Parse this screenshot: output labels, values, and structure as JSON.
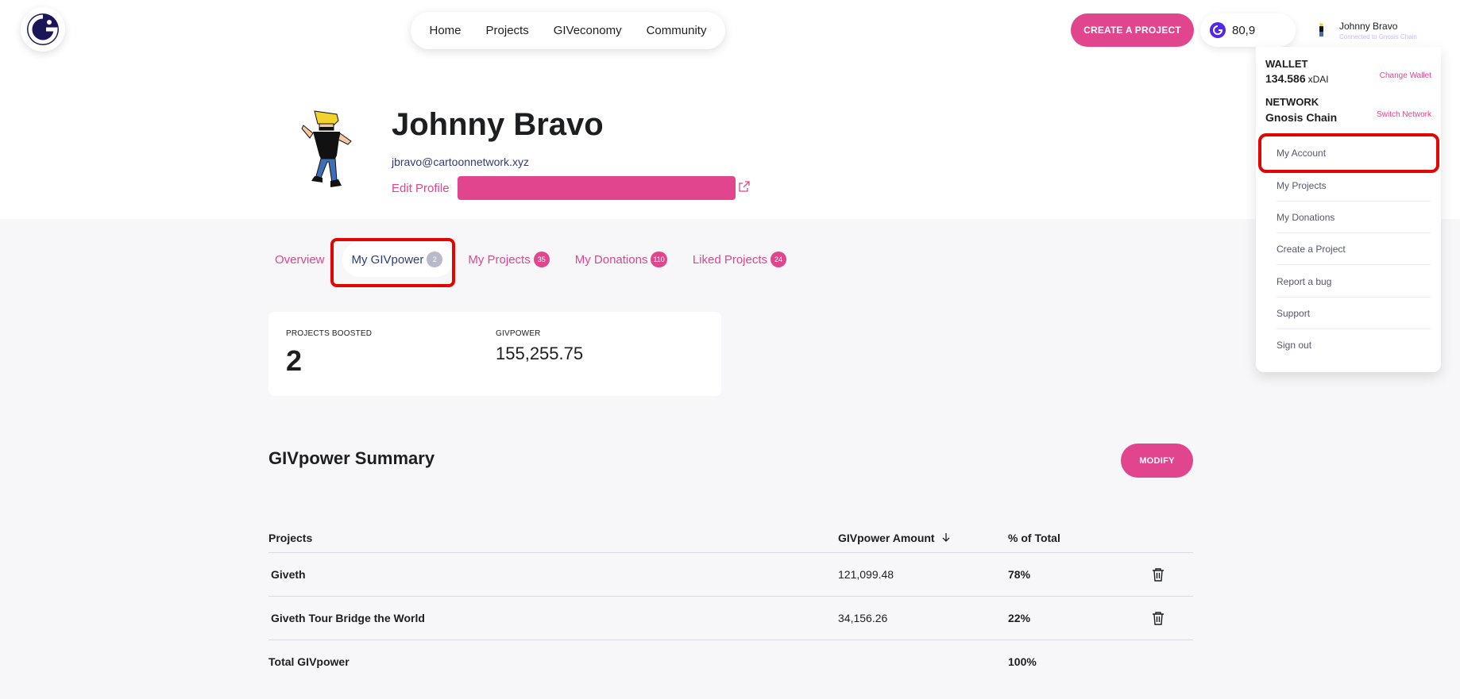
{
  "nav": {
    "items": [
      "Home",
      "Projects",
      "GIVeconomy",
      "Community"
    ]
  },
  "header": {
    "create_project_label": "CREATE A PROJECT",
    "giv_balance": "80,9",
    "user_name": "Johnny Bravo",
    "user_connection": "Connected to Gnosis Chain"
  },
  "dropdown": {
    "wallet_title": "WALLET",
    "wallet_amount": "134.586",
    "wallet_unit": "xDAI",
    "change_wallet": "Change Wallet",
    "network_title": "NETWORK",
    "network_name": "Gnosis Chain",
    "switch_network": "Switch Network",
    "items": [
      "My Account",
      "My Projects",
      "My Donations",
      "Create a Project",
      "Report a bug",
      "Support",
      "Sign out"
    ]
  },
  "profile": {
    "name": "Johnny Bravo",
    "email": "jbravo@cartoonnetwork.xyz",
    "edit_profile": "Edit Profile"
  },
  "tabs": [
    {
      "label": "Overview",
      "count": ""
    },
    {
      "label": "My GIVpower",
      "count": "2"
    },
    {
      "label": "My Projects",
      "count": "35"
    },
    {
      "label": "My Donations",
      "count": "110"
    },
    {
      "label": "Liked Projects",
      "count": "24"
    }
  ],
  "stats": {
    "projects_boosted_label": "PROJECTS BOOSTED",
    "projects_boosted_value": "2",
    "givpower_label": "GIVPOWER",
    "givpower_value": "155,255.75"
  },
  "summary": {
    "title": "GIVpower Summary",
    "modify_label": "MODIFY",
    "headers": [
      "Projects",
      "GIVpower Amount",
      "% of Total"
    ],
    "rows": [
      {
        "project": "Giveth",
        "amount": "121,099.48",
        "percent": "78%"
      },
      {
        "project": "Giveth Tour Bridge the World",
        "amount": "34,156.26",
        "percent": "22%"
      }
    ],
    "total_label": "Total GIVpower",
    "total_percent": "100%"
  },
  "colors": {
    "brand_pink": "#e1458d",
    "highlight_red": "#e10600",
    "navy": "#303b72",
    "giv_purple": "#5326ec"
  }
}
